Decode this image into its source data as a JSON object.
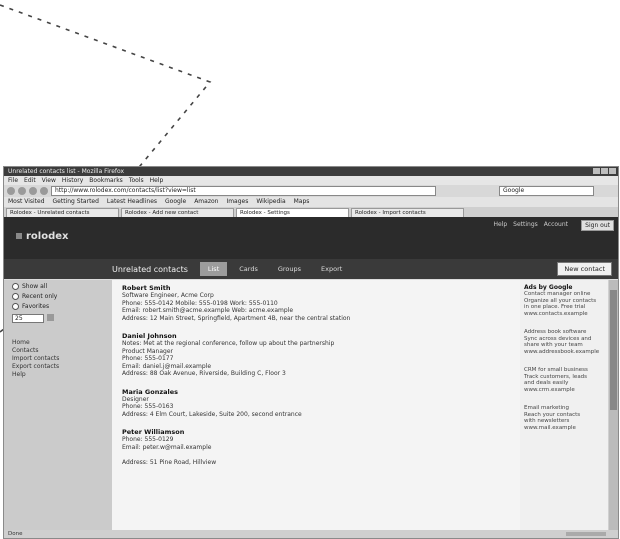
{
  "browser": {
    "window_title": "Unrelated contacts list - Mozilla Firefox",
    "menu_items": [
      "File",
      "Edit",
      "View",
      "History",
      "Bookmarks",
      "Tools",
      "Help"
    ],
    "url": "http://www.rolodex.com/contacts/list?view=list",
    "search_placeholder": "Google",
    "bookmarks": [
      "Most Visited",
      "Getting Started",
      "Latest Headlines",
      "Google",
      "Amazon",
      "Images",
      "Wikipedia",
      "Maps"
    ],
    "tabs": [
      "Rolodex - Unrelated contacts",
      "Rolodex - Add new contact",
      "Rolodex - Settings",
      "Rolodex - Import contacts"
    ],
    "status_text": "Done"
  },
  "site": {
    "logo": "rolodex",
    "user_links": [
      "Help",
      "Settings",
      "Account"
    ],
    "logout_label": "Sign out",
    "page_heading": "Unrelated contacts",
    "nav_tabs": [
      "List",
      "Cards",
      "Groups",
      "Export"
    ],
    "new_button": "New contact"
  },
  "left": {
    "radio_options": [
      "Show all",
      "Recent only",
      "Favorites"
    ],
    "count_value": "25",
    "links": [
      "Home",
      "Contacts",
      "Import contacts",
      "Export contacts",
      "Help"
    ]
  },
  "contacts": [
    {
      "name": "Robert Smith",
      "lines": [
        "Software Engineer, Acme Corp",
        "Phone: 555-0142   Mobile: 555-0198   Work: 555-0110",
        "Email: robert.smith@acme.example   Web: acme.example",
        "Address: 12 Main Street, Springfield, Apartment 4B, near the central station"
      ]
    },
    {
      "name": "Daniel Johnson",
      "lines": [
        "Notes: Met at the regional conference, follow up about the partnership",
        "Product Manager",
        "Phone: 555-0177",
        "Email: daniel.j@mail.example",
        "Address: 88 Oak Avenue, Riverside, Building C, Floor 3"
      ]
    },
    {
      "name": "Maria Gonzales",
      "lines": [
        "Designer",
        "Phone: 555-0163",
        "Address: 4 Elm Court, Lakeside, Suite 200, second entrance"
      ]
    },
    {
      "name": "Peter Williamson",
      "lines": [
        "Phone: 555-0129",
        "Email: peter.w@mail.example",
        "",
        "Address: 51 Pine Road, Hillview"
      ]
    }
  ],
  "ads": [
    {
      "title": "Ads by Google",
      "lines": [
        "Contact manager online",
        "Organize all your contacts",
        "in one place. Free trial",
        "www.contacts.example"
      ]
    },
    {
      "title": "",
      "lines": [
        "Address book software",
        "Sync across devices and",
        "share with your team",
        "www.addressbook.example"
      ]
    },
    {
      "title": "",
      "lines": [
        "CRM for small business",
        "Track customers, leads",
        "and deals easily",
        "www.crm.example"
      ]
    },
    {
      "title": "",
      "lines": [
        "Email marketing",
        "Reach your contacts",
        "with newsletters",
        "www.mail.example"
      ]
    }
  ]
}
